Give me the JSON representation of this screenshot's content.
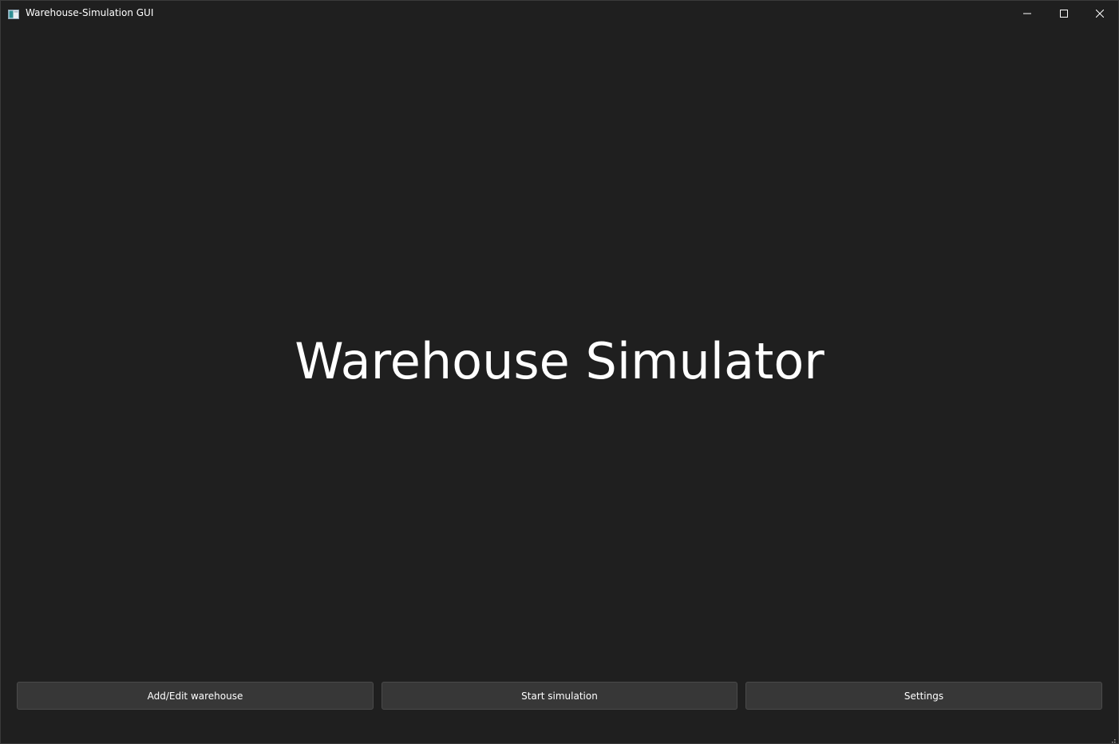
{
  "window": {
    "title": "Warehouse-Simulation GUI",
    "icon": "app-window-icon",
    "controls": {
      "minimize_icon": "minimize-icon",
      "maximize_icon": "maximize-icon",
      "close_icon": "close-icon"
    }
  },
  "main": {
    "title": "Warehouse Simulator"
  },
  "actions": {
    "add_edit_label": "Add/Edit warehouse",
    "start_label": "Start simulation",
    "settings_label": "Settings"
  },
  "theme": {
    "background": "#1f1f1f",
    "button_background": "#373737",
    "button_border": "#4a4a4a",
    "text": "#ffffff"
  },
  "status": {
    "resize_grip_icon": "resize-grip-icon"
  }
}
